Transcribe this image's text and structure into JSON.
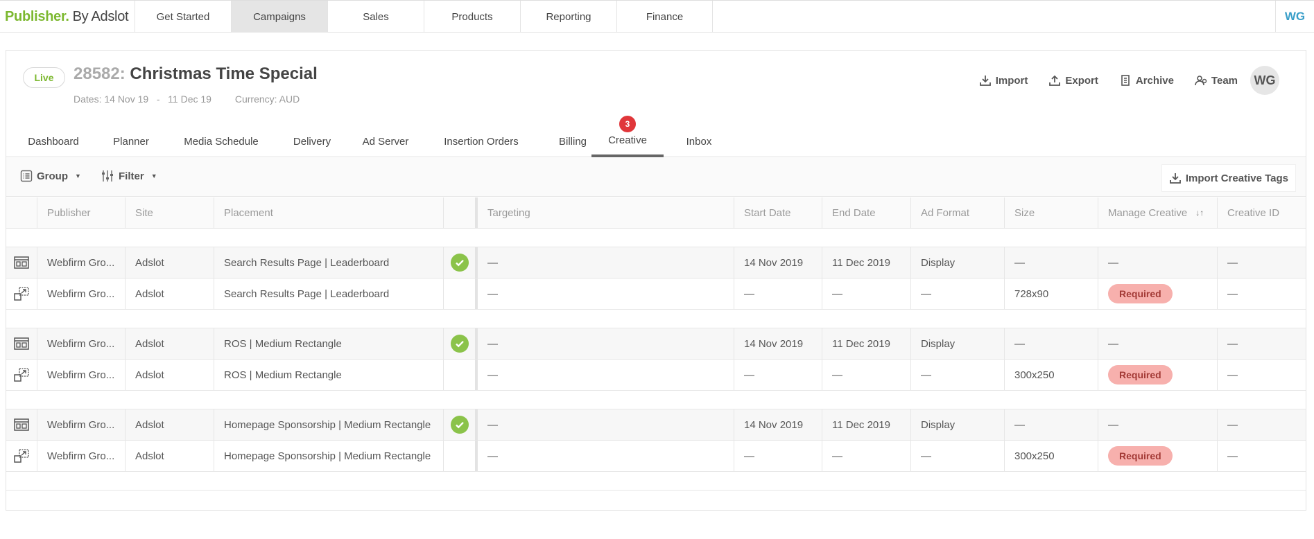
{
  "app": {
    "brand": "Publisher.",
    "brand_suffix": "By Adslot",
    "nav": [
      "Get Started",
      "Campaigns",
      "Sales",
      "Products",
      "Reporting",
      "Finance"
    ],
    "active_nav": "Campaigns",
    "user_initials": "WG"
  },
  "campaign": {
    "status": "Live",
    "id": "28582:",
    "name": "Christmas Time Special",
    "dates": "Dates: 14 Nov 19   -   11 Dec 19",
    "currency": "Currency: AUD",
    "avatar": "WG"
  },
  "actions": {
    "import": "Import",
    "export": "Export",
    "archive": "Archive",
    "team": "Team"
  },
  "tabs": {
    "dashboard": "Dashboard",
    "planner": "Planner",
    "media_schedule": "Media Schedule",
    "delivery": "Delivery",
    "ad_server": "Ad Server",
    "insertion_orders": "Insertion Orders",
    "billing": "Billing",
    "creative": "Creative",
    "inbox": "Inbox",
    "creative_badge": "3"
  },
  "toolbar": {
    "group": "Group",
    "filter": "Filter",
    "import_tags": "Import Creative Tags"
  },
  "columns": {
    "publisher": "Publisher",
    "site": "Site",
    "placement": "Placement",
    "targeting": "Targeting",
    "start": "Start Date",
    "end": "End Date",
    "format": "Ad Format",
    "size": "Size",
    "manage": "Manage Creative",
    "creative_id": "Creative ID"
  },
  "rows": [
    {
      "publisher": "Webfirm Gro...",
      "site": "Adslot",
      "placement": "Search Results Page | Leaderboard",
      "targeting": "—",
      "start": "14 Nov 2019",
      "end": "11 Dec 2019",
      "format": "Display",
      "size": "—",
      "manage": "—",
      "creative_id": "—"
    },
    {
      "publisher": "Webfirm Gro...",
      "site": "Adslot",
      "placement": "Search Results Page | Leaderboard",
      "targeting": "—",
      "start": "—",
      "end": "—",
      "format": "—",
      "size": "728x90",
      "manage": "Required",
      "creative_id": "—"
    },
    {
      "publisher": "Webfirm Gro...",
      "site": "Adslot",
      "placement": "ROS | Medium Rectangle",
      "targeting": "—",
      "start": "14 Nov 2019",
      "end": "11 Dec 2019",
      "format": "Display",
      "size": "—",
      "manage": "—",
      "creative_id": "—"
    },
    {
      "publisher": "Webfirm Gro...",
      "site": "Adslot",
      "placement": "ROS | Medium Rectangle",
      "targeting": "—",
      "start": "—",
      "end": "—",
      "format": "—",
      "size": "300x250",
      "manage": "Required",
      "creative_id": "—"
    },
    {
      "publisher": "Webfirm Gro...",
      "site": "Adslot",
      "placement": "Homepage Sponsorship | Medium Rectangle",
      "targeting": "—",
      "start": "14 Nov 2019",
      "end": "11 Dec 2019",
      "format": "Display",
      "size": "—",
      "manage": "—",
      "creative_id": "—"
    },
    {
      "publisher": "Webfirm Gro...",
      "site": "Adslot",
      "placement": "Homepage Sponsorship | Medium Rectangle",
      "targeting": "—",
      "start": "—",
      "end": "—",
      "format": "—",
      "size": "300x250",
      "manage": "Required",
      "creative_id": "—"
    }
  ],
  "colors": {
    "brand_green": "#7cb82f",
    "check_green": "#8bc34a",
    "badge_red": "#e0363a",
    "required_bg": "#f7b0ad",
    "user_blue": "#3a9fc9"
  }
}
